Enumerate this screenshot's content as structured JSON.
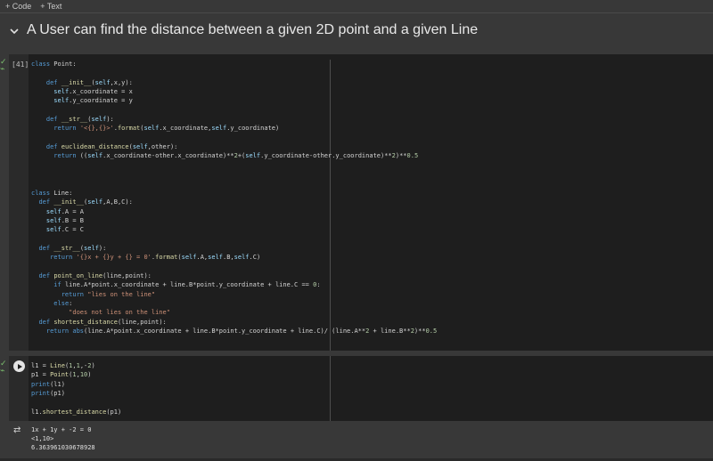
{
  "toolbar": {
    "add_code": "+ Code",
    "add_text": "+ Text"
  },
  "section": {
    "title": "A User can find the distance between a given 2D point and a given Line"
  },
  "cell1": {
    "exec_count": "[41]",
    "code_lines": [
      "class Point:",
      "",
      "    def __init__(self,x,y):",
      "      self.x_coordinate = x",
      "      self.y_coordinate = y",
      "",
      "    def __str__(self):",
      "      return '<{},{}>'.format(self.x_coordinate,self.y_coordinate)",
      "",
      "    def euclidean_distance(self,other):",
      "      return ((self.x_coordinate-other.x_coordinate)**2+(self.y_coordinate-other.y_coordinate)**2)**0.5",
      "",
      "",
      "",
      "class Line:",
      "  def __init__(self,A,B,C):",
      "    self.A = A",
      "    self.B = B",
      "    self.C = C",
      "",
      "  def __str__(self):",
      "     return '{}x + {}y + {} = 0'.format(self.A,self.B,self.C)",
      "",
      "  def point_on_line(line,point):",
      "      if line.A*point.x_coordinate + line.B*point.y_coordinate + line.C == 0:",
      "        return \"lies on the line\"",
      "      else:",
      "          \"does not lies on the line\"",
      "  def shortest_distance(line,point):",
      "    return abs(line.A*point.x_coordinate + line.B*point.y_coordinate + line.C)/ (line.A**2 + line.B**2)**0.5"
    ]
  },
  "cell2": {
    "code_lines": [
      "l1 = Line(1,1,-2)",
      "p1 = Point(1,10)",
      "print(l1)",
      "print(p1)",
      "",
      "l1.shortest_distance(p1)"
    ]
  },
  "output": {
    "lines": [
      "1x + 1y + -2 = 0",
      "<1,10>",
      "6.363961030678928"
    ]
  },
  "icons": {
    "status": "check-icon",
    "run": "play-icon",
    "output": "output-icon",
    "chevron": "chevron-down-icon"
  }
}
